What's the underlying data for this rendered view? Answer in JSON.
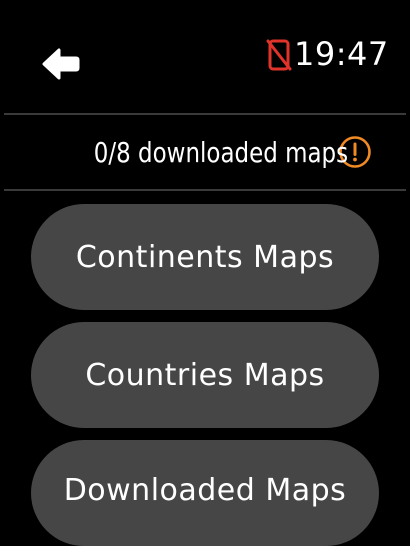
{
  "status_bar": {
    "time": "19:47",
    "back_icon": "left-arrow-icon",
    "phone_status_icon": "phone-disconnected-icon",
    "phone_status_color": "#e0342a"
  },
  "download_status": {
    "text": "0/8 downloaded maps",
    "warning_icon": "exclamation-circle-icon",
    "warning_color": "#f08a24"
  },
  "menu": {
    "items": [
      {
        "label": "Continents Maps"
      },
      {
        "label": "Countries Maps"
      },
      {
        "label": "Downloaded Maps"
      }
    ]
  },
  "colors": {
    "background": "#000000",
    "button": "#464646",
    "divider": "#3a3a3a",
    "text": "#ffffff"
  }
}
